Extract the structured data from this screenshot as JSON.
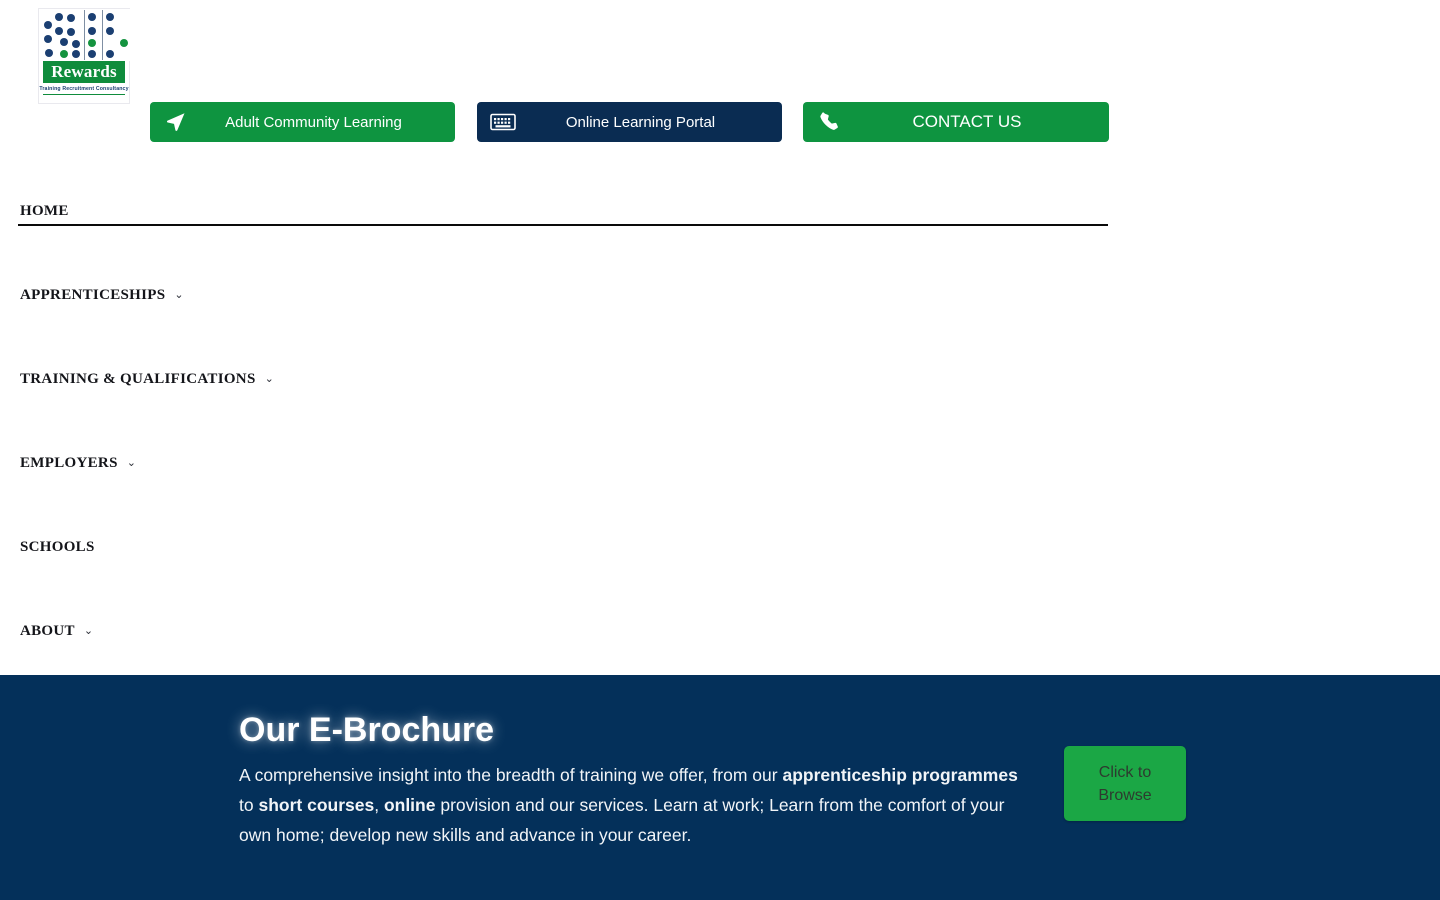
{
  "logo": {
    "name": "Rewards",
    "tagline": "Training Recruitment Consultancy",
    "colors": {
      "navy": "#1b3f72",
      "green": "#0f8c3c"
    }
  },
  "top_buttons": [
    {
      "label": "Adult Community Learning",
      "icon": "navigation-arrow-icon",
      "bg": "#0e9440"
    },
    {
      "label": "Online Learning Portal",
      "icon": "keyboard-icon",
      "bg": "#0a2c52"
    },
    {
      "label": "CONTACT US",
      "icon": "phone-icon",
      "bg": "#0e9440"
    }
  ],
  "nav": {
    "active": "HOME",
    "items": [
      {
        "label": "HOME",
        "has_submenu": false,
        "chevron": ""
      },
      {
        "label": "APPRENTICESHIPS",
        "has_submenu": true,
        "chevron": "⌄"
      },
      {
        "label": "TRAINING & QUALIFICATIONS",
        "has_submenu": true,
        "chevron": "⌄"
      },
      {
        "label": "EMPLOYERS",
        "has_submenu": true,
        "chevron": "⌄"
      },
      {
        "label": "SCHOOLS",
        "has_submenu": false,
        "chevron": ""
      },
      {
        "label": "ABOUT",
        "has_submenu": true,
        "chevron": "⌄"
      }
    ]
  },
  "brochure": {
    "title": "Our E-Brochure",
    "body_part_1": "A comprehensive insight into the breadth of training we offer, from our ",
    "body_bold_1": "apprenticeship programmes",
    "body_part_2": " to ",
    "body_bold_2": "short courses",
    "body_part_3": ", ",
    "body_bold_3": "online",
    "body_part_4": " provision and our services. Learn at work; Learn from the comfort of your own home; develop new skills and advance in your career.",
    "button_label": "Click to Browse",
    "background": "#04305a",
    "button_color": "#1ba745"
  }
}
